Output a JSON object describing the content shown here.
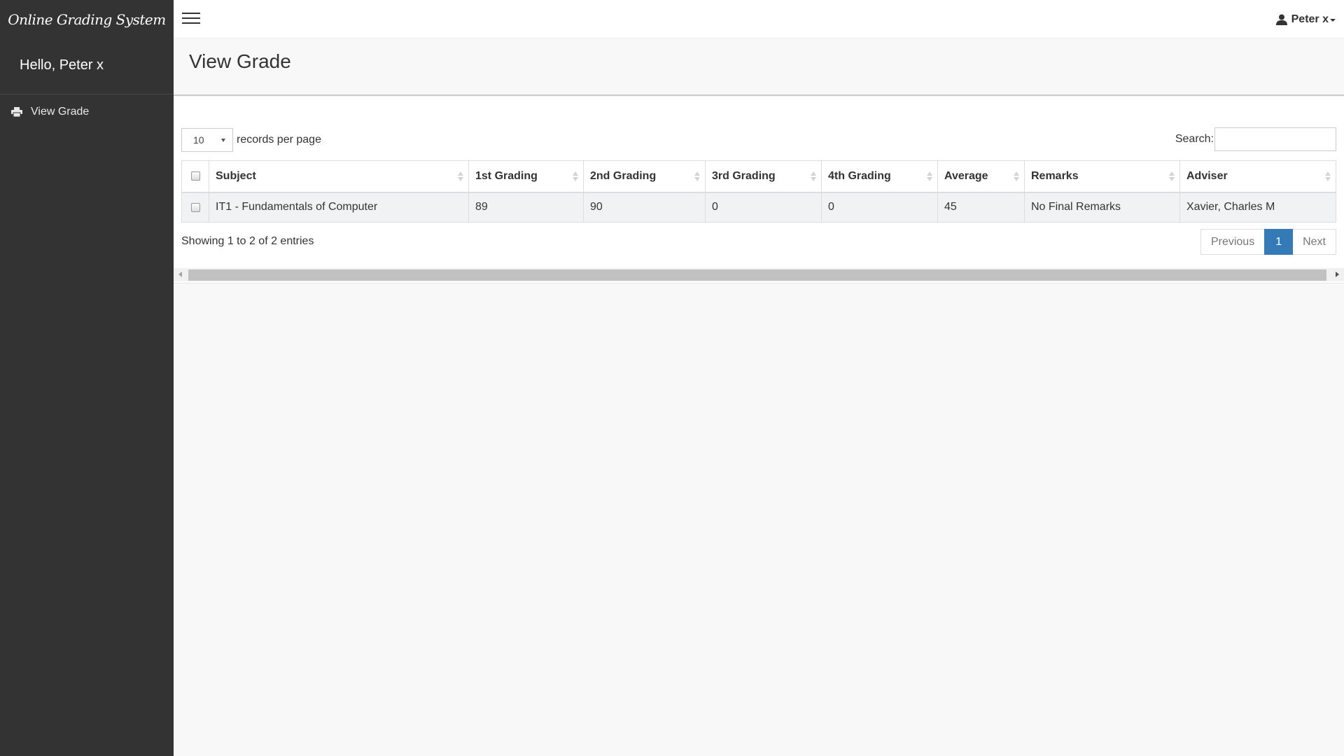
{
  "sidebar": {
    "brand": "Online Grading System",
    "greeting": "Hello, Peter x",
    "items": [
      {
        "label": "View Grade",
        "icon": "print-icon"
      }
    ]
  },
  "topbar": {
    "menu_icon": "hamburger-icon",
    "user_name": "Peter x",
    "user_icon": "user-icon"
  },
  "page": {
    "title": "View Grade"
  },
  "table_controls": {
    "length_value": "10",
    "length_label": "records per page",
    "search_label": "Search:",
    "search_value": ""
  },
  "table": {
    "columns": [
      "Subject",
      "1st Grading",
      "2nd Grading",
      "3rd Grading",
      "4th Grading",
      "Average",
      "Remarks",
      "Adviser"
    ],
    "rows": [
      {
        "subject": "IT1 - Fundamentals of Computer",
        "g1": "89",
        "g2": "90",
        "g3": "0",
        "g4": "0",
        "average": "45",
        "remarks": "No Final Remarks",
        "adviser": "Xavier, Charles M"
      }
    ]
  },
  "footer": {
    "info": "Showing 1 to 2 of 2 entries",
    "previous": "Previous",
    "current_page": "1",
    "next": "Next"
  }
}
